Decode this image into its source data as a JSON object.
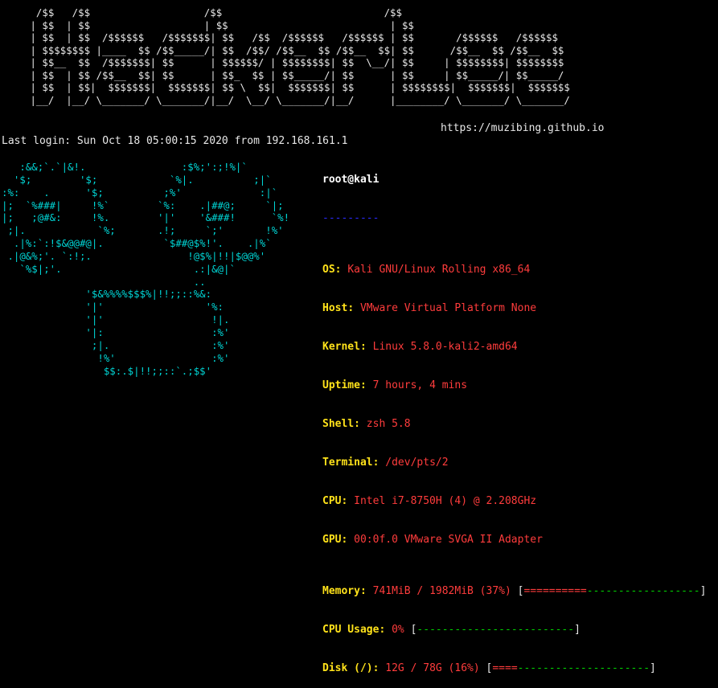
{
  "banner_art": "  /$$   /$$                   /$$                           /$$\n | $$  | $$                   | $$                           | $$\n | $$  | $$  /$$$$$$   /$$$$$$$| $$   /$$  /$$$$$$   /$$$$$$ | $$       /$$$$$$   /$$$$$$\n | $$$$$$$$ |____  $$ /$$_____/| $$  /$$/ /$$__  $$ /$$__  $$| $$      /$$__  $$ /$$__  $$\n | $$__  $$  /$$$$$$$| $$      | $$$$$$/ | $$$$$$$$| $$  \\__/| $$     | $$$$$$$$| $$$$$$$$\n | $$  | $$ /$$__  $$| $$      | $$_  $$ | $$_____/| $$      | $$     | $$_____/| $$_____/\n | $$  | $$|  $$$$$$$|  $$$$$$$| $$ \\  $$|  $$$$$$$| $$      | $$$$$$$$|  $$$$$$$|  $$$$$$$\n |__/  |__/ \\_______/ \\_______/|__/  \\__/ \\_______/|__/      |________/ \\_______/ \\_______/",
  "url": "https://muzibing.github.io",
  "last_login": "Last login: Sun Oct 18 05:00:15 2020 from 192.168.161.1",
  "logo_art": "   :&&;`.`|&!.                :$%;':;!%|`\n  '$;        '$;            `%|.          ;|`\n:%:    .      '$;          ;%'             :|`\n|;  `%###|     !%`        `%:    .|##@;     `|;\n|;   ;@#&:     !%.        '|'    '&###!      `%!\n ;|.            `%;       .!;     `;'       !%'\n  .|%:`:!$&@@#@|.          `$##@$%!'.    .|%`\n .|@&%;'. `:!;.                !@$%|!!|$@@%'\n   `%$|;'.                      .:|&@|`\n                                ..\n              '$&%%%%$$$%|!!;;::%&:\n              '|'                 '%:\n              '|'                  !|.\n              '|:                  :%'\n               ;|.                 :%'\n                !%'                :%'\n                 $$:.$|!!;;::`.;$$'",
  "user_host": "root@kali",
  "separator": "---------",
  "info": [
    {
      "key": "OS",
      "value": "Kali GNU/Linux Rolling x86_64"
    },
    {
      "key": "Host",
      "value": "VMware Virtual Platform None"
    },
    {
      "key": "Kernel",
      "value": "Linux 5.8.0-kali2-amd64"
    },
    {
      "key": "Uptime",
      "value": "7 hours, 4 mins"
    },
    {
      "key": "Shell",
      "value": "zsh 5.8"
    },
    {
      "key": "Terminal",
      "value": "/dev/pts/2"
    },
    {
      "key": "CPU",
      "value": "Intel i7-8750H (4) @ 2.208GHz"
    },
    {
      "key": "GPU",
      "value": "00:0f.0 VMware SVGA II Adapter"
    },
    {
      "key": "Memory",
      "value": "741MiB / 1982MiB (37%)",
      "bar_used": "==========",
      "bar_free": "------------------"
    },
    {
      "key": "CPU Usage",
      "value": "0%",
      "bar_used": "",
      "bar_free": "-------------------------"
    },
    {
      "key": "Disk (/)",
      "value": "12G / 78G (16%)",
      "bar_used": "====",
      "bar_free": "---------------------"
    }
  ],
  "colors": {
    "background": "#000000",
    "logo": "#00d5d5",
    "key": "#ffe21a",
    "value": "#ff3c3c",
    "separator": "#2a2aff",
    "bar_free": "#00d000"
  }
}
